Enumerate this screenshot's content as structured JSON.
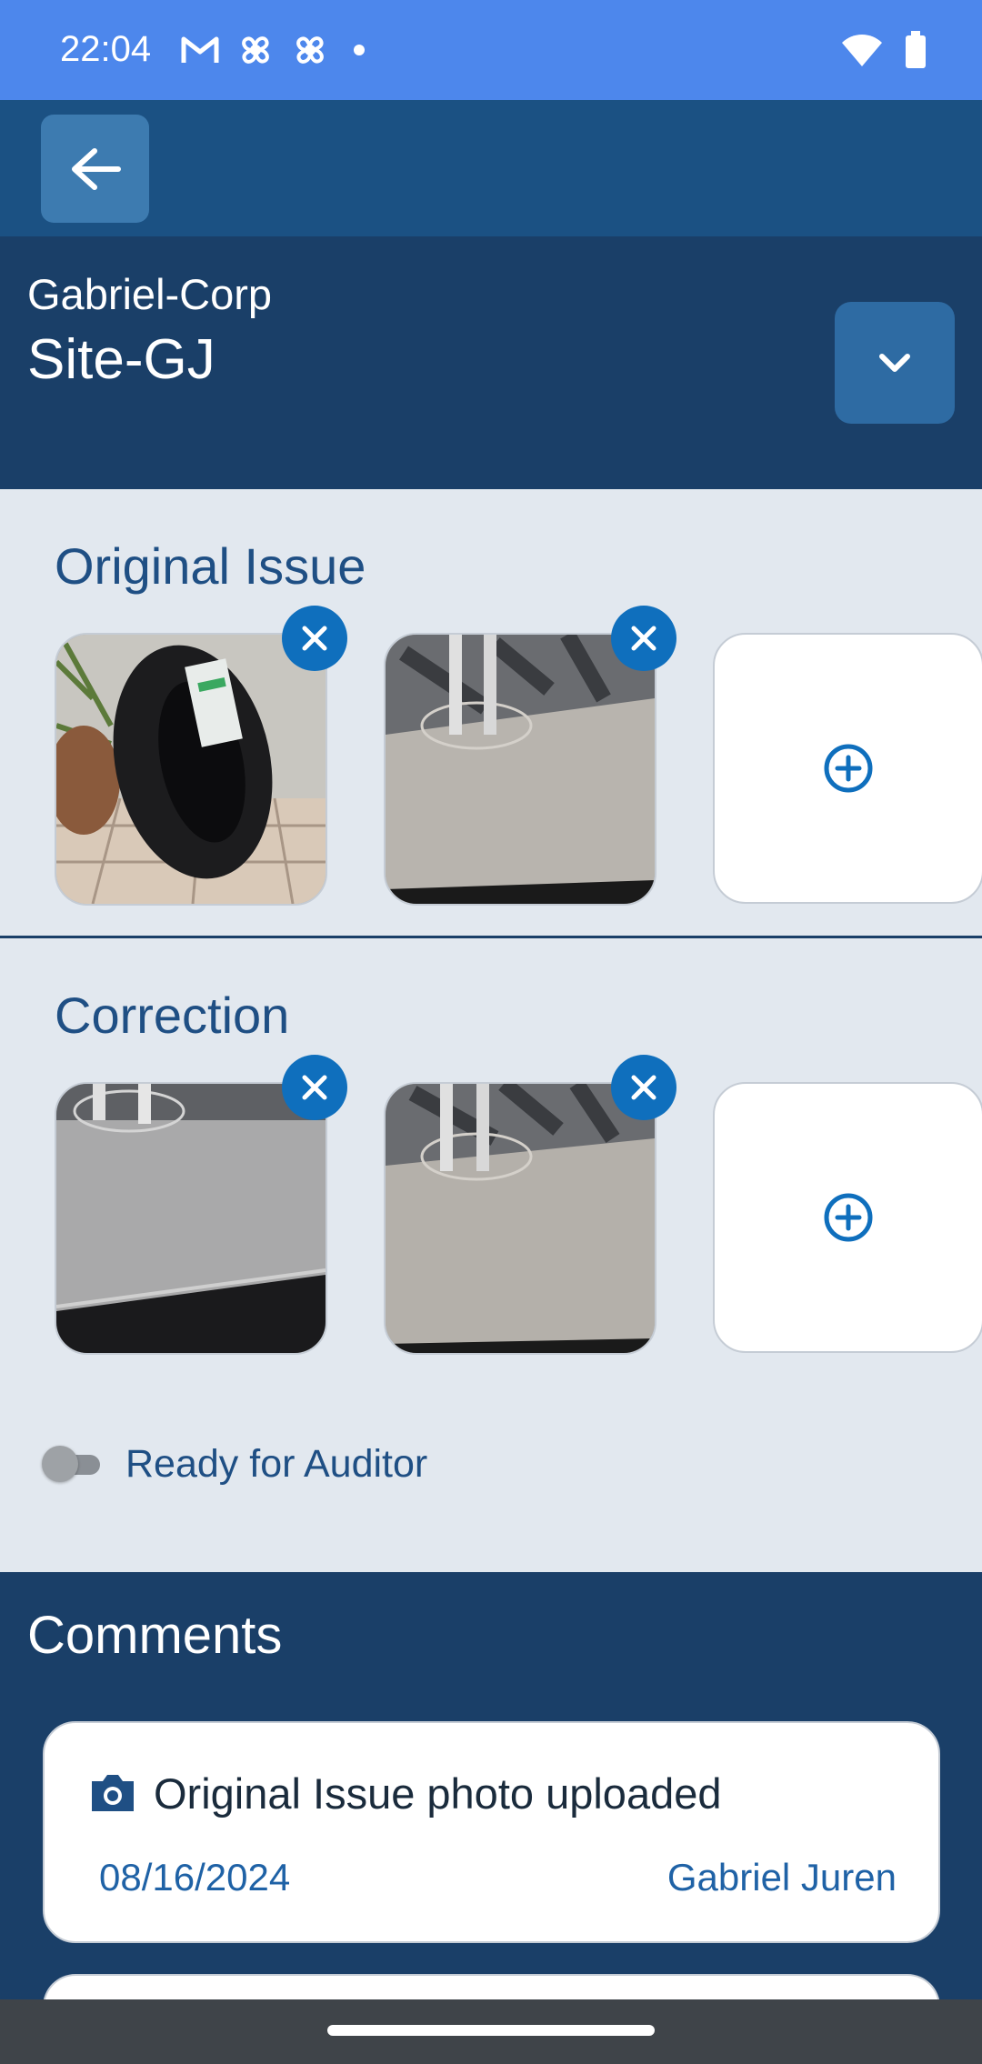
{
  "status_bar": {
    "time": "22:04",
    "left_icons": [
      "gmail-icon",
      "fan-icon",
      "fan-icon",
      "dot-icon"
    ],
    "right_icons": [
      "wifi-icon",
      "battery-icon"
    ]
  },
  "header": {
    "back_icon": "arrow-left-icon",
    "company": "Gabriel-Corp",
    "site": "Site-GJ",
    "dropdown_icon": "chevron-down-icon"
  },
  "original_issue": {
    "title": "Original Issue",
    "photos": [
      "tire-photo",
      "floor-photo"
    ],
    "add_icon": "add-circle-icon"
  },
  "correction": {
    "title": "Correction",
    "photos": [
      "floor-photo",
      "floor-photo"
    ],
    "add_icon": "add-circle-icon"
  },
  "toggle": {
    "label": "Ready for Auditor",
    "on": false
  },
  "comments": {
    "title": "Comments",
    "items": [
      {
        "icon": "camera-icon",
        "text": "Original Issue photo uploaded",
        "date": "08/16/2024",
        "author": "Gabriel Juren"
      }
    ]
  },
  "colors": {
    "status_bar": "#4d87ec",
    "app_bar": "#1b5183",
    "header": "#1a3f68",
    "accent": "#0f6fbd",
    "text_blue": "#1f4f84"
  }
}
